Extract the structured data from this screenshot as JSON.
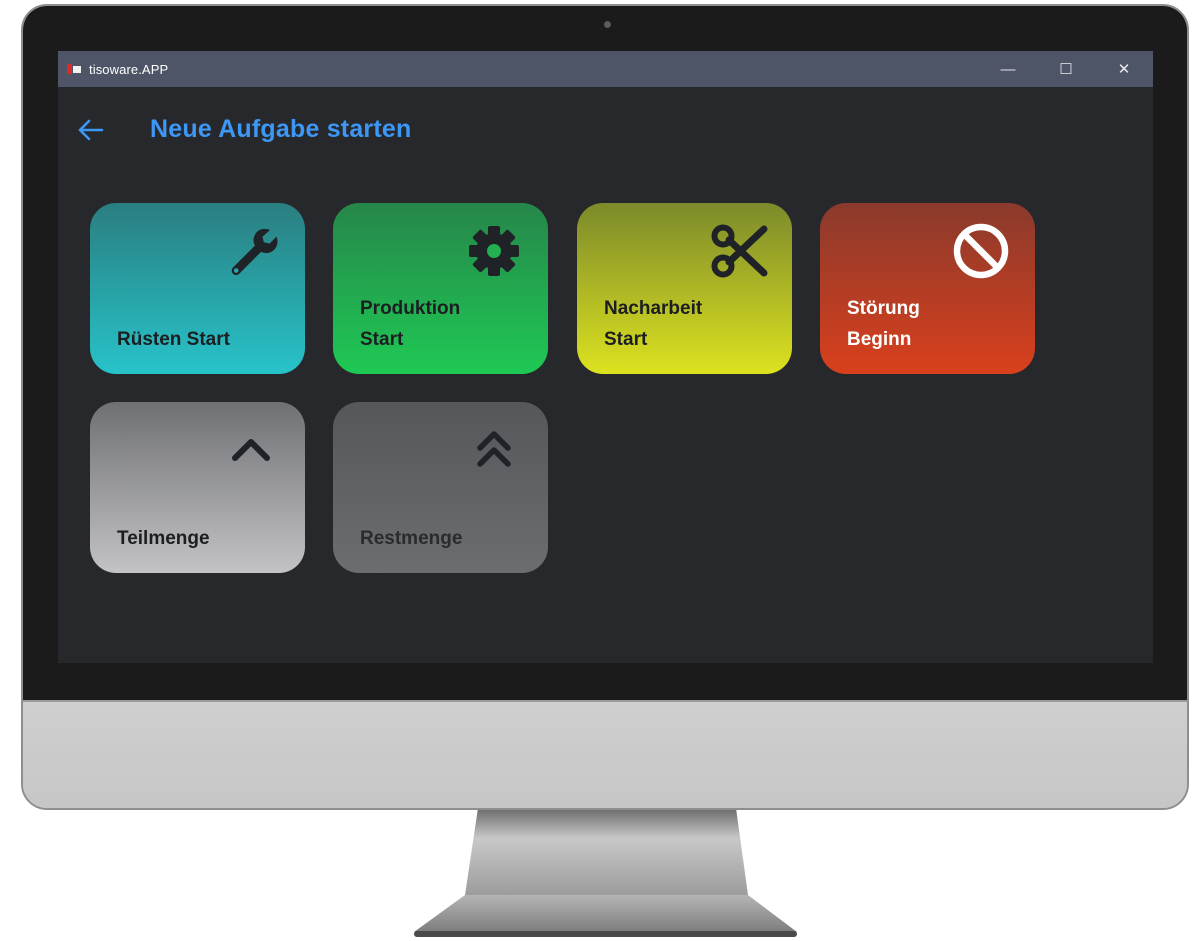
{
  "window": {
    "app_title": "tisoware.APP",
    "controls": {
      "minimize": "—",
      "maximize": "☐",
      "close": "✕"
    }
  },
  "header": {
    "title": "Neue Aufgabe starten"
  },
  "tiles": [
    {
      "label": "Rüsten Start",
      "icon": "wrench-icon",
      "gradient": [
        "#2a7e80",
        "#27c3c9"
      ],
      "text_color": "#1c1e22"
    },
    {
      "label": "Produktion\nStart",
      "icon": "gear-icon",
      "gradient": [
        "#26864a",
        "#1fc954"
      ],
      "text_color": "#1c1e22"
    },
    {
      "label": "Nacharbeit\nStart",
      "icon": "scissors-icon",
      "gradient": [
        "#7c8a2b",
        "#dde21f"
      ],
      "text_color": "#1c1e22"
    },
    {
      "label": "Störung\nBeginn",
      "icon": "no-entry-icon",
      "gradient": [
        "#8a3a2c",
        "#d9401d"
      ],
      "text_color": "#ffffff"
    },
    {
      "label": "Teilmenge",
      "icon": "chevron-up-icon",
      "gradient": [
        "#6f7074",
        "#c3c3c5"
      ],
      "text_color": "#1c1e22"
    },
    {
      "label": "Restmenge",
      "icon": "double-chevron-up-icon",
      "gradient": [
        "#55575b",
        "#6c6d70"
      ],
      "text_color": "#2a2b2e"
    }
  ],
  "colors": {
    "accent": "#3d97f5",
    "background": "#27282c",
    "titlebar": "#4d5566"
  }
}
